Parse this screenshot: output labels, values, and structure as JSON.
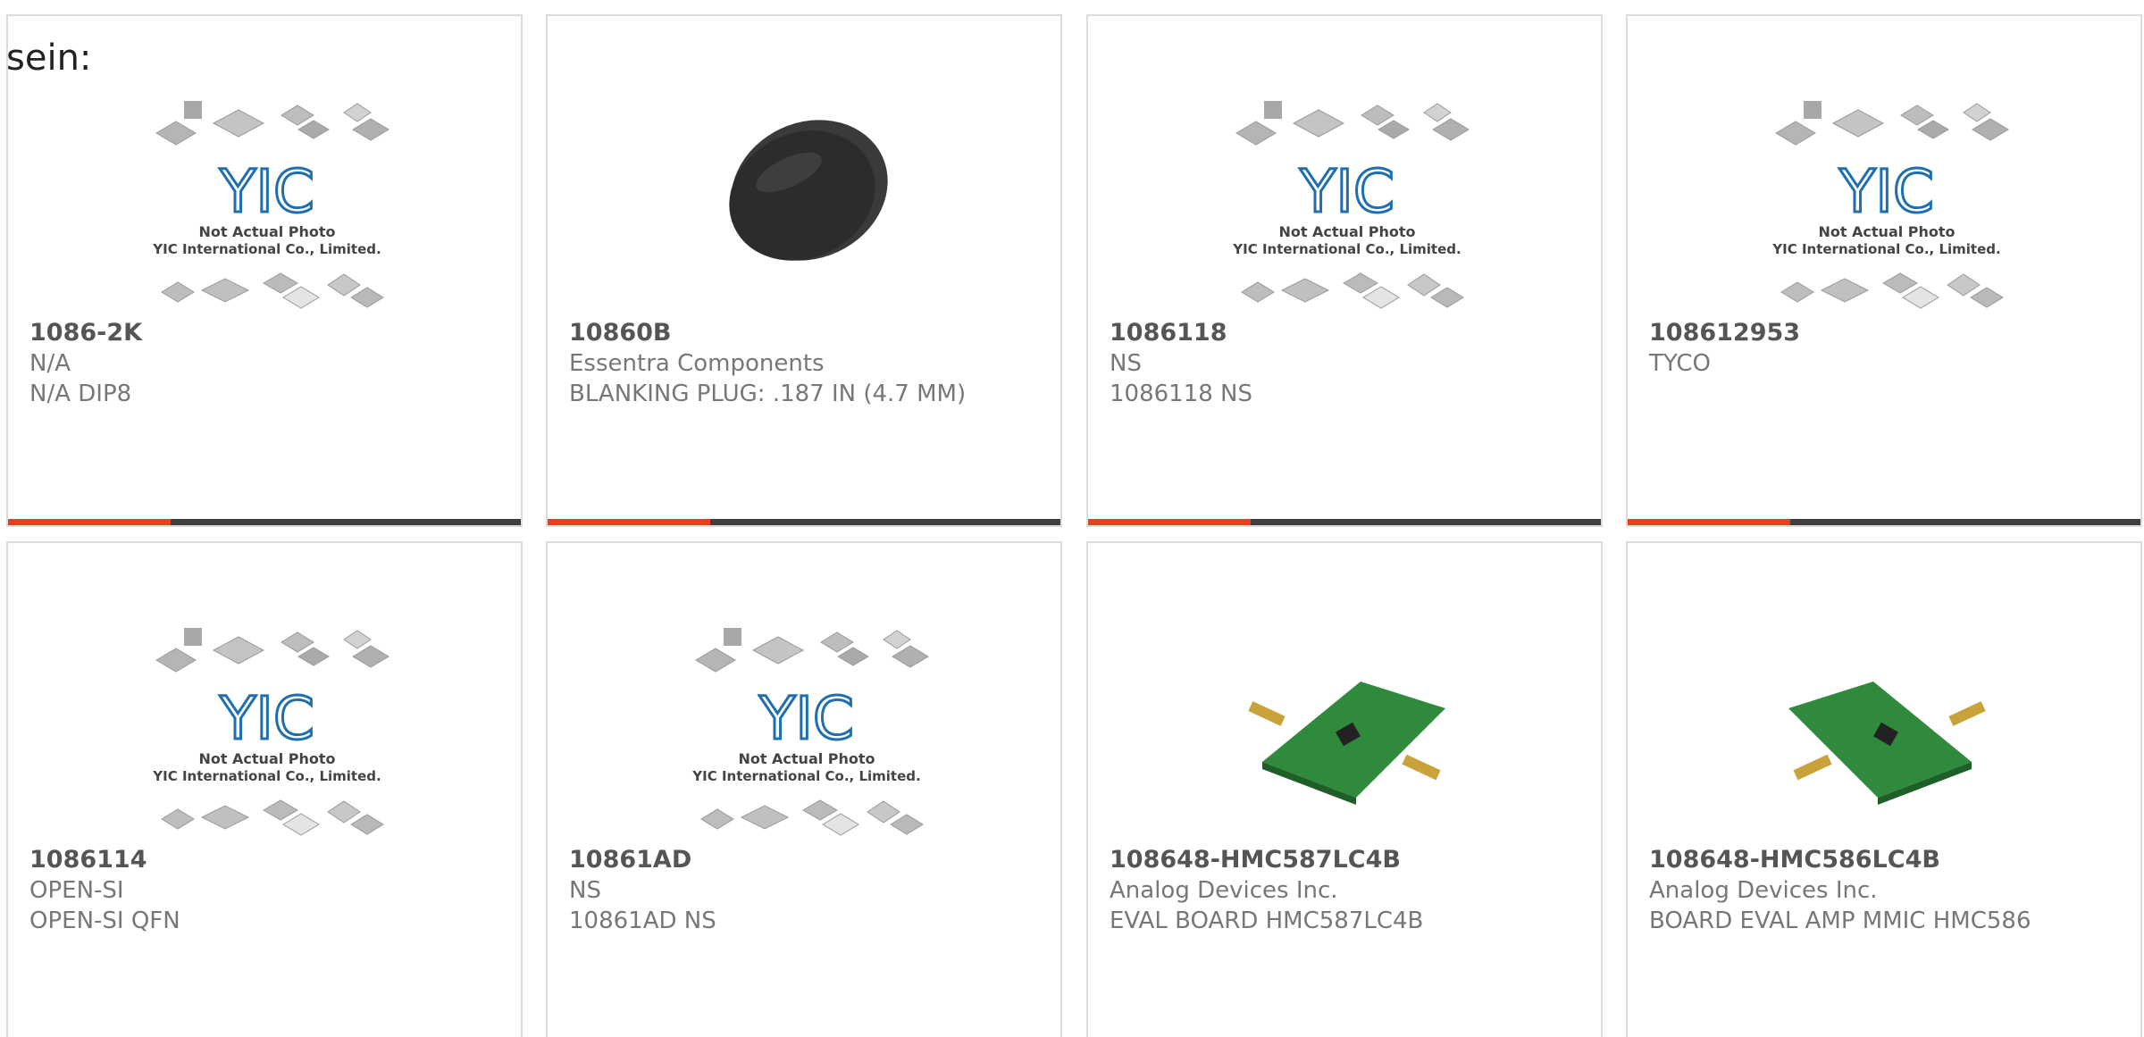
{
  "intro_text": "sein:",
  "colors": {
    "accent": "#e8401c",
    "bar": "#3f3f3f",
    "border": "#dcdcdc",
    "logo_blue": "#1f6fb0"
  },
  "placeholder_image": {
    "icon": "yic-not-actual-photo-icon",
    "logo_text": "YIC",
    "caption_line1": "Not Actual Photo",
    "caption_line2": "YIC International Co., Limited."
  },
  "products": [
    {
      "part_number": "1086-2K",
      "manufacturer": "N/A",
      "description": "N/A DIP8",
      "image": "placeholder"
    },
    {
      "part_number": "10860B",
      "manufacturer": "Essentra Components",
      "description": "BLANKING PLUG: .187 IN (4.7 MM)",
      "image": "black-plug-icon"
    },
    {
      "part_number": "1086118",
      "manufacturer": "NS",
      "description": "1086118 NS",
      "image": "placeholder"
    },
    {
      "part_number": "108612953",
      "manufacturer": "TYCO",
      "description": "",
      "image": "placeholder"
    },
    {
      "part_number": "1086114",
      "manufacturer": "OPEN-SI",
      "description": "OPEN-SI QFN",
      "image": "placeholder"
    },
    {
      "part_number": "10861AD",
      "manufacturer": "NS",
      "description": "10861AD NS",
      "image": "placeholder"
    },
    {
      "part_number": "108648-HMC587LC4B",
      "manufacturer": "Analog Devices Inc.",
      "description": "EVAL BOARD HMC587LC4B",
      "image": "eval-board-icon"
    },
    {
      "part_number": "108648-HMC586LC4B",
      "manufacturer": "Analog Devices Inc.",
      "description": "BOARD EVAL AMP MMIC HMC586",
      "image": "eval-board-icon"
    }
  ]
}
